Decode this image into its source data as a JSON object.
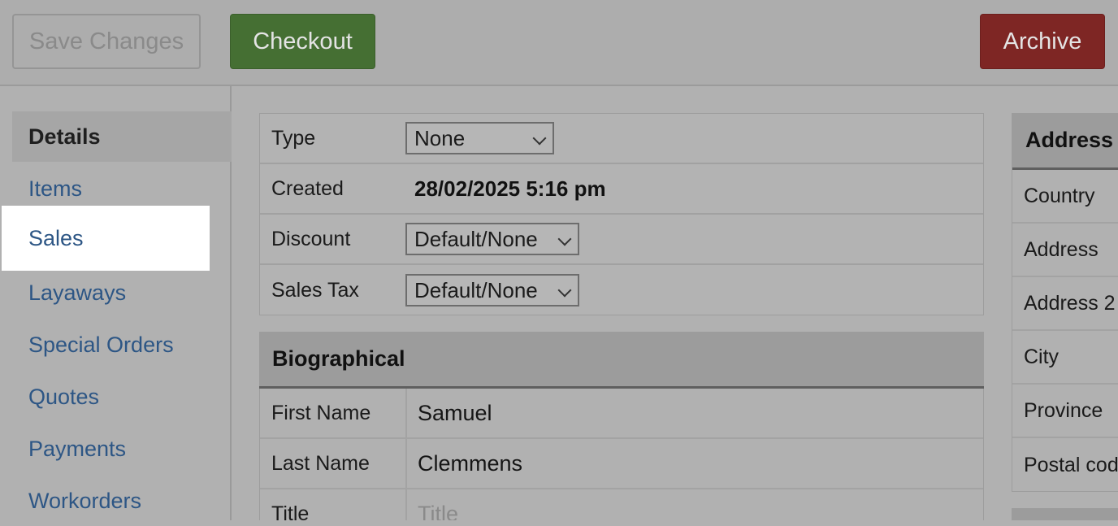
{
  "toolbar": {
    "save_label": "Save Changes",
    "checkout_label": "Checkout",
    "archive_label": "Archive"
  },
  "sidebar": {
    "items": [
      {
        "label": "Details",
        "state": "active"
      },
      {
        "label": "Items"
      },
      {
        "label": "Sales",
        "state": "highlighted"
      },
      {
        "label": "Layaways"
      },
      {
        "label": "Special Orders"
      },
      {
        "label": "Quotes"
      },
      {
        "label": "Payments"
      },
      {
        "label": "Workorders"
      }
    ]
  },
  "details": {
    "type_label": "Type",
    "type_value": "None",
    "created_label": "Created",
    "created_value": "28/02/2025 5:16 pm",
    "discount_label": "Discount",
    "discount_value": "Default/None",
    "sales_tax_label": "Sales Tax",
    "sales_tax_value": "Default/None"
  },
  "biographical": {
    "header": "Biographical",
    "first_name_label": "First Name",
    "first_name_value": "Samuel",
    "last_name_label": "Last Name",
    "last_name_value": "Clemmens",
    "title_label": "Title",
    "title_placeholder": "Title"
  },
  "address": {
    "header": "Address",
    "rows": [
      "Country",
      "Address",
      "Address 2",
      "City",
      "Province",
      "Postal code"
    ]
  },
  "colors": {
    "checkout": "#456f33",
    "archive": "#7e2624",
    "link": "#2d5685"
  }
}
